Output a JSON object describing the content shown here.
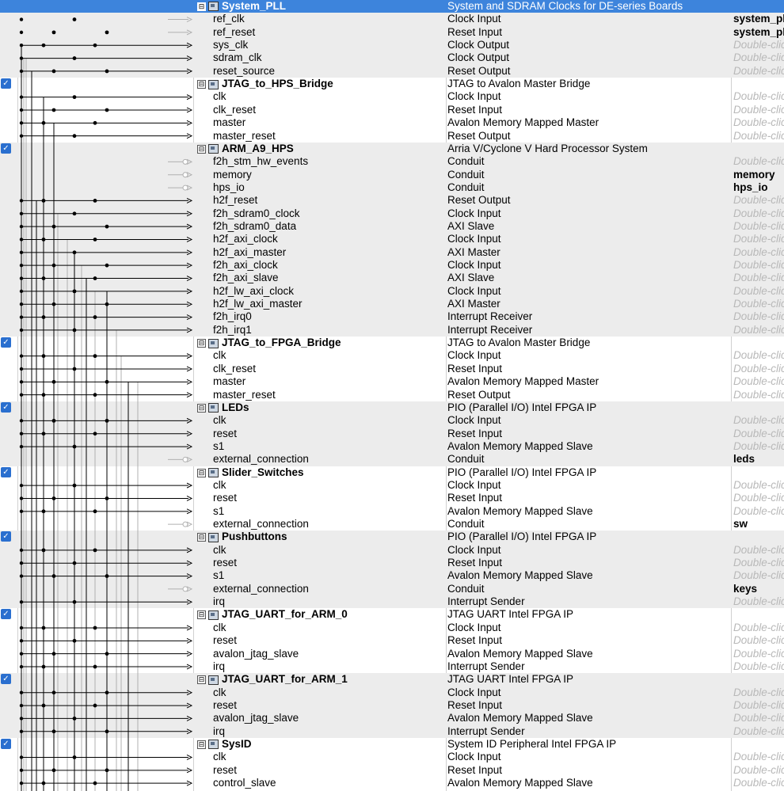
{
  "rows": [
    {
      "kind": "comp",
      "name": "System_PLL",
      "desc": "System and SDRAM Clocks for DE-series Boards",
      "checked": false,
      "selected": true
    },
    {
      "kind": "if",
      "name": "ref_clk",
      "desc": "Clock Input",
      "export": "system_pll_ref_clk",
      "exp_type": "val"
    },
    {
      "kind": "if",
      "name": "ref_reset",
      "desc": "Reset Input",
      "export": "system_pll_ref_reset",
      "exp_type": "val"
    },
    {
      "kind": "if",
      "name": "sys_clk",
      "desc": "Clock Output",
      "export": "Double-click to export",
      "exp_type": "hint"
    },
    {
      "kind": "if",
      "name": "sdram_clk",
      "desc": "Clock Output",
      "export": "Double-click to export",
      "exp_type": "hint"
    },
    {
      "kind": "if",
      "name": "reset_source",
      "desc": "Reset Output",
      "export": "Double-click to export",
      "exp_type": "hint"
    },
    {
      "kind": "comp",
      "name": "JTAG_to_HPS_Bridge",
      "desc": "JTAG to Avalon Master Bridge",
      "checked": true
    },
    {
      "kind": "if",
      "name": "clk",
      "desc": "Clock Input",
      "export": "Double-click to export",
      "exp_type": "hint"
    },
    {
      "kind": "if",
      "name": "clk_reset",
      "desc": "Reset Input",
      "export": "Double-click to export",
      "exp_type": "hint"
    },
    {
      "kind": "if",
      "name": "master",
      "desc": "Avalon Memory Mapped Master",
      "export": "Double-click to export",
      "exp_type": "hint"
    },
    {
      "kind": "if",
      "name": "master_reset",
      "desc": "Reset Output",
      "export": "Double-click to export",
      "exp_type": "hint"
    },
    {
      "kind": "comp",
      "name": "ARM_A9_HPS",
      "desc": "Arria V/Cyclone V Hard Processor System",
      "checked": true
    },
    {
      "kind": "if",
      "name": "f2h_stm_hw_events",
      "desc": "Conduit",
      "export": "Double-click to export",
      "exp_type": "hint"
    },
    {
      "kind": "if",
      "name": "memory",
      "desc": "Conduit",
      "export": "memory",
      "exp_type": "val"
    },
    {
      "kind": "if",
      "name": "hps_io",
      "desc": "Conduit",
      "export": "hps_io",
      "exp_type": "val"
    },
    {
      "kind": "if",
      "name": "h2f_reset",
      "desc": "Reset Output",
      "export": "Double-click to export",
      "exp_type": "hint"
    },
    {
      "kind": "if",
      "name": "f2h_sdram0_clock",
      "desc": "Clock Input",
      "export": "Double-click to export",
      "exp_type": "hint"
    },
    {
      "kind": "if",
      "name": "f2h_sdram0_data",
      "desc": "AXI Slave",
      "export": "Double-click to export",
      "exp_type": "hint"
    },
    {
      "kind": "if",
      "name": "h2f_axi_clock",
      "desc": "Clock Input",
      "export": "Double-click to export",
      "exp_type": "hint"
    },
    {
      "kind": "if",
      "name": "h2f_axi_master",
      "desc": "AXI Master",
      "export": "Double-click to export",
      "exp_type": "hint"
    },
    {
      "kind": "if",
      "name": "f2h_axi_clock",
      "desc": "Clock Input",
      "export": "Double-click to export",
      "exp_type": "hint"
    },
    {
      "kind": "if",
      "name": "f2h_axi_slave",
      "desc": "AXI Slave",
      "export": "Double-click to export",
      "exp_type": "hint"
    },
    {
      "kind": "if",
      "name": "h2f_lw_axi_clock",
      "desc": "Clock Input",
      "export": "Double-click to export",
      "exp_type": "hint"
    },
    {
      "kind": "if",
      "name": "h2f_lw_axi_master",
      "desc": "AXI Master",
      "export": "Double-click to export",
      "exp_type": "hint"
    },
    {
      "kind": "if",
      "name": "f2h_irq0",
      "desc": "Interrupt Receiver",
      "export": "Double-click to export",
      "exp_type": "hint"
    },
    {
      "kind": "if",
      "name": "f2h_irq1",
      "desc": "Interrupt Receiver",
      "export": "Double-click to export",
      "exp_type": "hint"
    },
    {
      "kind": "comp",
      "name": "JTAG_to_FPGA_Bridge",
      "desc": "JTAG to Avalon Master Bridge",
      "checked": true
    },
    {
      "kind": "if",
      "name": "clk",
      "desc": "Clock Input",
      "export": "Double-click to export",
      "exp_type": "hint"
    },
    {
      "kind": "if",
      "name": "clk_reset",
      "desc": "Reset Input",
      "export": "Double-click to export",
      "exp_type": "hint"
    },
    {
      "kind": "if",
      "name": "master",
      "desc": "Avalon Memory Mapped Master",
      "export": "Double-click to export",
      "exp_type": "hint"
    },
    {
      "kind": "if",
      "name": "master_reset",
      "desc": "Reset Output",
      "export": "Double-click to export",
      "exp_type": "hint"
    },
    {
      "kind": "comp",
      "name": "LEDs",
      "desc": "PIO (Parallel I/O) Intel FPGA IP",
      "checked": true
    },
    {
      "kind": "if",
      "name": "clk",
      "desc": "Clock Input",
      "export": "Double-click to export",
      "exp_type": "hint"
    },
    {
      "kind": "if",
      "name": "reset",
      "desc": "Reset Input",
      "export": "Double-click to export",
      "exp_type": "hint"
    },
    {
      "kind": "if",
      "name": "s1",
      "desc": "Avalon Memory Mapped Slave",
      "export": "Double-click to export",
      "exp_type": "hint"
    },
    {
      "kind": "if",
      "name": "external_connection",
      "desc": "Conduit",
      "export": "leds",
      "exp_type": "val"
    },
    {
      "kind": "comp",
      "name": "Slider_Switches",
      "desc": "PIO (Parallel I/O) Intel FPGA IP",
      "checked": true
    },
    {
      "kind": "if",
      "name": "clk",
      "desc": "Clock Input",
      "export": "Double-click to export",
      "exp_type": "hint"
    },
    {
      "kind": "if",
      "name": "reset",
      "desc": "Reset Input",
      "export": "Double-click to export",
      "exp_type": "hint"
    },
    {
      "kind": "if",
      "name": "s1",
      "desc": "Avalon Memory Mapped Slave",
      "export": "Double-click to export",
      "exp_type": "hint"
    },
    {
      "kind": "if",
      "name": "external_connection",
      "desc": "Conduit",
      "export": "sw",
      "exp_type": "val"
    },
    {
      "kind": "comp",
      "name": "Pushbuttons",
      "desc": "PIO (Parallel I/O) Intel FPGA IP",
      "checked": true
    },
    {
      "kind": "if",
      "name": "clk",
      "desc": "Clock Input",
      "export": "Double-click to export",
      "exp_type": "hint"
    },
    {
      "kind": "if",
      "name": "reset",
      "desc": "Reset Input",
      "export": "Double-click to export",
      "exp_type": "hint"
    },
    {
      "kind": "if",
      "name": "s1",
      "desc": "Avalon Memory Mapped Slave",
      "export": "Double-click to export",
      "exp_type": "hint"
    },
    {
      "kind": "if",
      "name": "external_connection",
      "desc": "Conduit",
      "export": "keys",
      "exp_type": "val"
    },
    {
      "kind": "if",
      "name": "irq",
      "desc": "Interrupt Sender",
      "export": "Double-click to export",
      "exp_type": "hint"
    },
    {
      "kind": "comp",
      "name": "JTAG_UART_for_ARM_0",
      "desc": "JTAG UART Intel FPGA IP",
      "checked": true
    },
    {
      "kind": "if",
      "name": "clk",
      "desc": "Clock Input",
      "export": "Double-click to export",
      "exp_type": "hint"
    },
    {
      "kind": "if",
      "name": "reset",
      "desc": "Reset Input",
      "export": "Double-click to export",
      "exp_type": "hint"
    },
    {
      "kind": "if",
      "name": "avalon_jtag_slave",
      "desc": "Avalon Memory Mapped Slave",
      "export": "Double-click to export",
      "exp_type": "hint"
    },
    {
      "kind": "if",
      "name": "irq",
      "desc": "Interrupt Sender",
      "export": "Double-click to export",
      "exp_type": "hint"
    },
    {
      "kind": "comp",
      "name": "JTAG_UART_for_ARM_1",
      "desc": "JTAG UART Intel FPGA IP",
      "checked": true
    },
    {
      "kind": "if",
      "name": "clk",
      "desc": "Clock Input",
      "export": "Double-click to export",
      "exp_type": "hint"
    },
    {
      "kind": "if",
      "name": "reset",
      "desc": "Reset Input",
      "export": "Double-click to export",
      "exp_type": "hint"
    },
    {
      "kind": "if",
      "name": "avalon_jtag_slave",
      "desc": "Avalon Memory Mapped Slave",
      "export": "Double-click to export",
      "exp_type": "hint"
    },
    {
      "kind": "if",
      "name": "irq",
      "desc": "Interrupt Sender",
      "export": "Double-click to export",
      "exp_type": "hint"
    },
    {
      "kind": "comp",
      "name": "SysID",
      "desc": "System ID Peripheral Intel FPGA IP",
      "checked": true
    },
    {
      "kind": "if",
      "name": "clk",
      "desc": "Clock Input",
      "export": "Double-click to export",
      "exp_type": "hint"
    },
    {
      "kind": "if",
      "name": "reset",
      "desc": "Reset Input",
      "export": "Double-click to export",
      "exp_type": "hint"
    },
    {
      "kind": "if",
      "name": "control_slave",
      "desc": "Avalon Memory Mapped Slave",
      "export": "Double-click to export",
      "exp_type": "hint"
    }
  ],
  "toggle_glyph": "⊟",
  "checkmark": "✓",
  "colors": {
    "selection": "#3d84dc",
    "alt_row": "#ececec",
    "wire": "#000000",
    "wire_dim": "#b0b0b0",
    "hint": "#b8b8b8"
  }
}
